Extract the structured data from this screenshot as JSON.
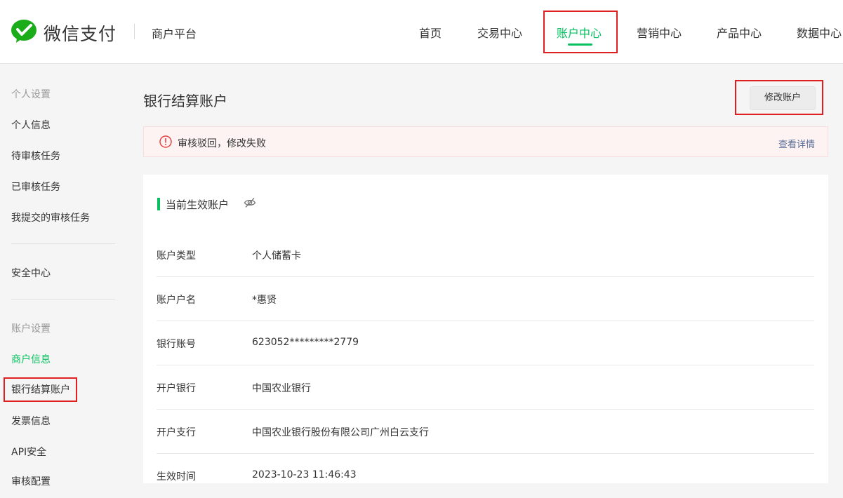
{
  "header": {
    "brand": "微信支付",
    "platform": "商户平台",
    "nav": [
      {
        "label": "首页"
      },
      {
        "label": "交易中心"
      },
      {
        "label": "账户中心"
      },
      {
        "label": "营销中心"
      },
      {
        "label": "产品中心"
      },
      {
        "label": "数据中心"
      }
    ],
    "active_nav": "账户中心"
  },
  "sidebar": {
    "group1": "个人设置",
    "items1": [
      "个人信息",
      "待审核任务",
      "已审核任务",
      "我提交的审核任务"
    ],
    "security": "安全中心",
    "group2": "账户设置",
    "items2": [
      "商户信息",
      "银行结算账户",
      "发票信息",
      "API安全",
      "审核配置"
    ]
  },
  "main": {
    "title": "银行结算账户",
    "modify_button": "修改账户",
    "alert": {
      "text": "审核驳回，修改失败",
      "link": "查看详情"
    },
    "section_title": "当前生效账户",
    "rows": [
      {
        "label": "账户类型",
        "value": "个人储蓄卡"
      },
      {
        "label": "账户户名",
        "value": "*惠贤"
      },
      {
        "label": "银行账号",
        "value": "623052*********2779"
      },
      {
        "label": "开户银行",
        "value": "中国农业银行"
      },
      {
        "label": "开户支行",
        "value": "中国农业银行股份有限公司广州白云支行"
      },
      {
        "label": "生效时间",
        "value": "2023-10-23 11:46:43"
      }
    ]
  },
  "colors": {
    "accent": "#07c160",
    "highlight_box": "#e02020",
    "link": "#576b95",
    "alert_bg": "#fdf3f3"
  },
  "icons": [
    "wechat-pay-logo",
    "error-circle-icon",
    "eye-hidden-icon"
  ]
}
